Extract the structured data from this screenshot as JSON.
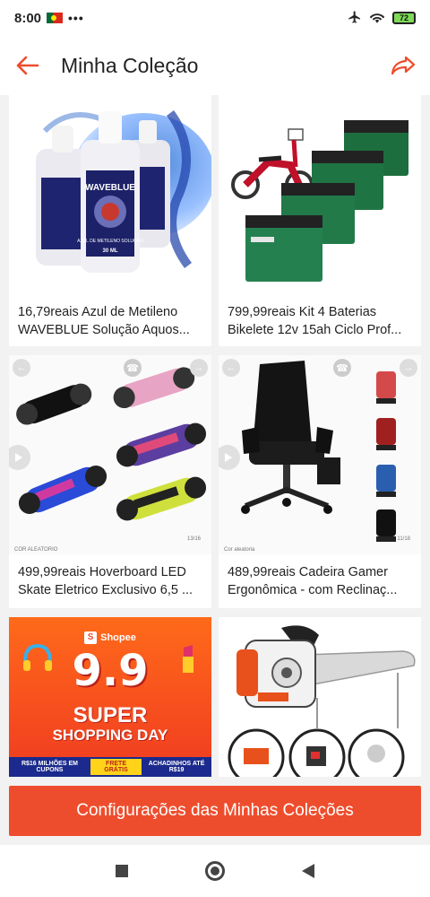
{
  "status_bar": {
    "time": "8:00",
    "dots": "•••",
    "battery": "72"
  },
  "header": {
    "title": "Minha Coleção"
  },
  "products": [
    {
      "line1": "16,79reais Azul de Metileno",
      "line2": "WAVEBLUE Solução Aquos..."
    },
    {
      "line1": "799,99reais Kit 4 Baterias",
      "line2": "Bikelete 12v 15ah Ciclo Prof..."
    },
    {
      "line1": "499,99reais Hoverboard LED",
      "line2": "Skate Eletrico Exclusivo 6,5 ..."
    },
    {
      "line1": "489,99reais Cadeira Gamer",
      "line2": "Ergonômica - com Reclinaç..."
    }
  ],
  "images": {
    "bottle_label": "WAVEBLUE",
    "bottle_sub": "AZUL DE METILENO SOLUÇÃO",
    "bottle_vol": "30 ML",
    "hoverboard_counter": "13/16",
    "hoverboard_tag": "COR ALEATORIO",
    "chair_counter": "11/18",
    "chair_tag": "Cor aleatoria"
  },
  "promo": {
    "brand": "Shopee",
    "big": "9.9",
    "super": "SUPER",
    "day": "SHOPPING DAY",
    "badge_left": "R$16 MILHÕES EM CUPONS",
    "badge_mid": "FRETE GRÁTIS",
    "badge_right": "ACHADINHOS ATÉ R$19"
  },
  "footer": {
    "settings_label": "Configurações das Minhas Coleções"
  },
  "colors": {
    "accent": "#ee4d2d",
    "background": "#f2f2f2"
  }
}
